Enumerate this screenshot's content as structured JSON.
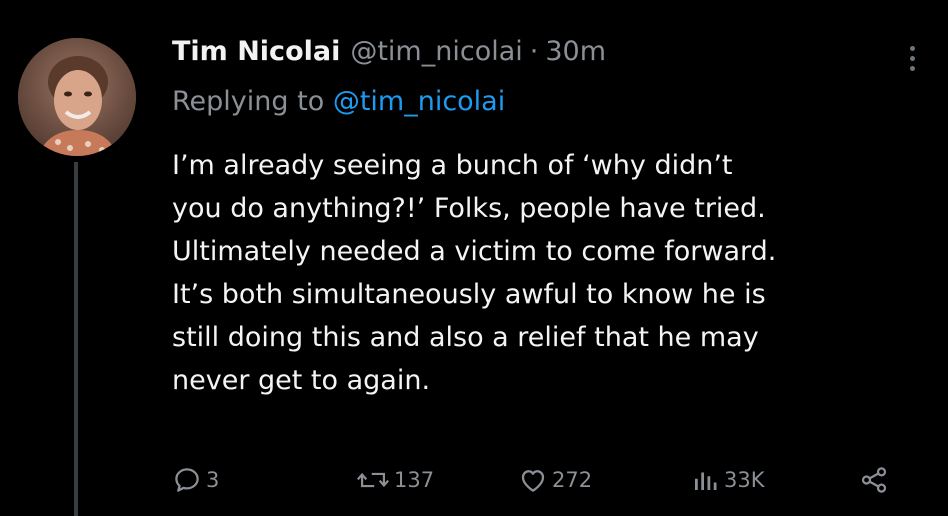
{
  "tweet": {
    "display_name": "Tim Nicolai",
    "handle": "@tim_nicolai",
    "separator": "·",
    "time": "30m",
    "replying_prefix": "Replying to",
    "replying_handle": "@tim_nicolai",
    "lines": [
      "I’m already seeing a bunch of ‘why didn’t",
      "you do anything?!’ Folks, people have tried.",
      "Ultimately needed a victim to come forward.",
      "It’s both simultaneously awful to know he is",
      "still doing this and also a relief that he may",
      "never get to again."
    ],
    "stats": {
      "replies": "3",
      "retweets": "137",
      "likes": "272",
      "views": "33K"
    }
  },
  "icons": {
    "reply": "reply-bubble-icon",
    "retweet": "retweet-arrows-icon",
    "like": "heart-icon",
    "views": "bar-chart-icon",
    "share": "share-nodes-icon",
    "more": "more-vertical-icon"
  },
  "colors": {
    "background": "#000000",
    "text": "#e7e9ea",
    "muted": "#8b9096",
    "link": "#1d9bf0",
    "thread_line": "#3a3d40"
  }
}
